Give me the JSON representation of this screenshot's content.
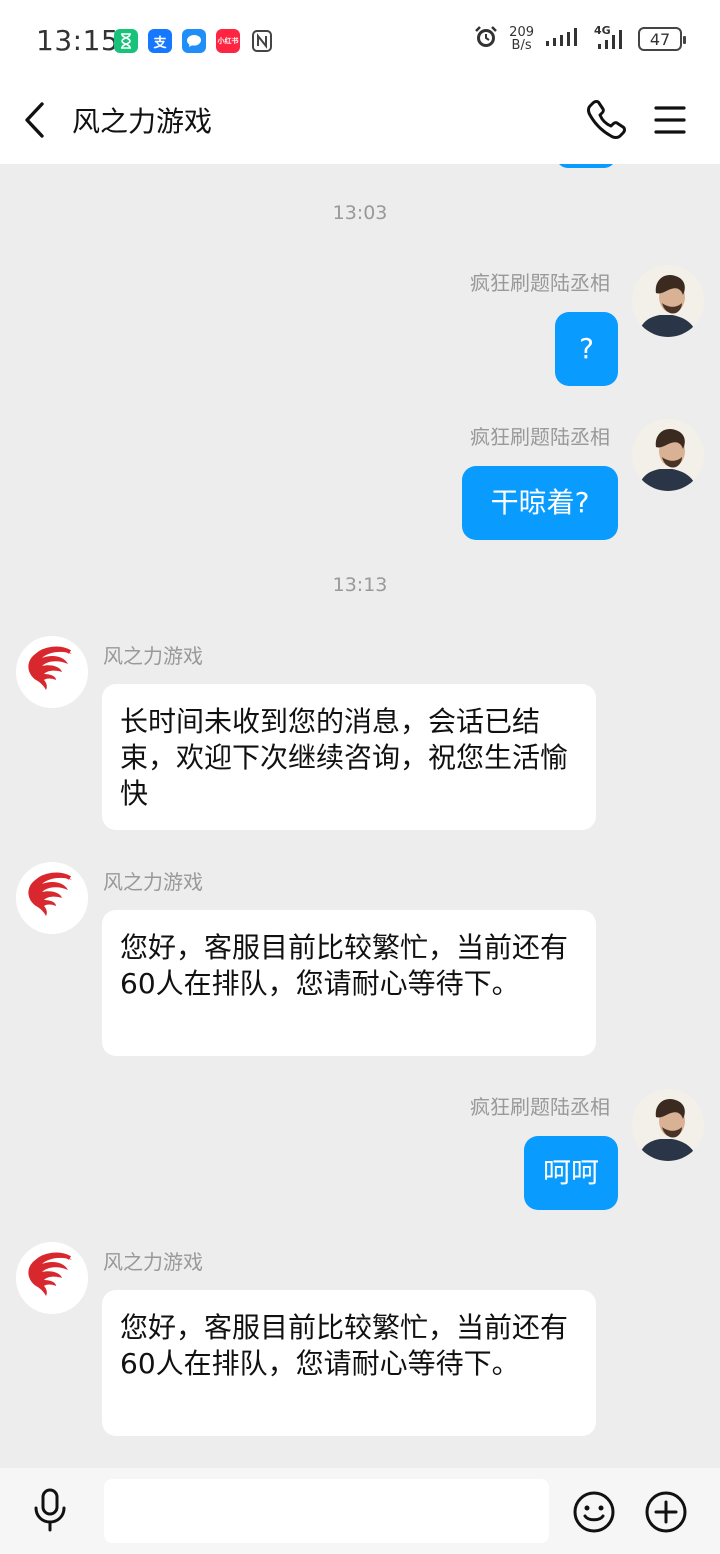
{
  "status_bar": {
    "time": "13:15",
    "net_speed_value": "209",
    "net_speed_unit": "B/s",
    "signal_label": "4G",
    "battery": "47",
    "app_icons": [
      {
        "name": "hourglass-app-icon",
        "glyph": "⌛",
        "color": "#18c27b"
      },
      {
        "name": "alipay-icon",
        "glyph": "支",
        "color": "#1677ff"
      },
      {
        "name": "message-app-icon",
        "glyph": "💬",
        "color": "#1f8ff7"
      },
      {
        "name": "xiaohongshu-icon",
        "glyph": "小红书",
        "color": "#ff2442"
      }
    ]
  },
  "header": {
    "title": "风之力游戏",
    "icons": [
      "back-icon",
      "phone-icon",
      "menu-icon"
    ]
  },
  "chat": {
    "timestamps": [
      "13:03",
      "13:13"
    ],
    "me_name": "疯狂刷题陆丞相",
    "bot_name": "风之力游戏",
    "messages": [
      {
        "from": "me",
        "sender": "疯狂刷题陆丞相",
        "text": "?"
      },
      {
        "from": "me",
        "sender": "疯狂刷题陆丞相",
        "text": "干晾着?"
      },
      {
        "from": "them",
        "sender": "风之力游戏",
        "text": "长时间未收到您的消息，会话已结束，欢迎下次继续咨询，祝您生活愉快"
      },
      {
        "from": "them",
        "sender": "风之力游戏",
        "text": "您好，客服目前比较繁忙，当前还有60人在排队，您请耐心等待下。"
      },
      {
        "from": "me",
        "sender": "疯狂刷题陆丞相",
        "text": "呵呵"
      },
      {
        "from": "them",
        "sender": "风之力游戏",
        "text": "您好，客服目前比较繁忙，当前还有60人在排队，您请耐心等待下。"
      }
    ]
  },
  "input_bar": {
    "placeholder": "",
    "icons": [
      "microphone-icon",
      "emoji-icon",
      "plus-icon"
    ]
  },
  "colors": {
    "my_bubble": "#0a9bff",
    "their_bubble": "#ffffff",
    "background": "#ededed",
    "bot_logo": "#d9272e"
  }
}
